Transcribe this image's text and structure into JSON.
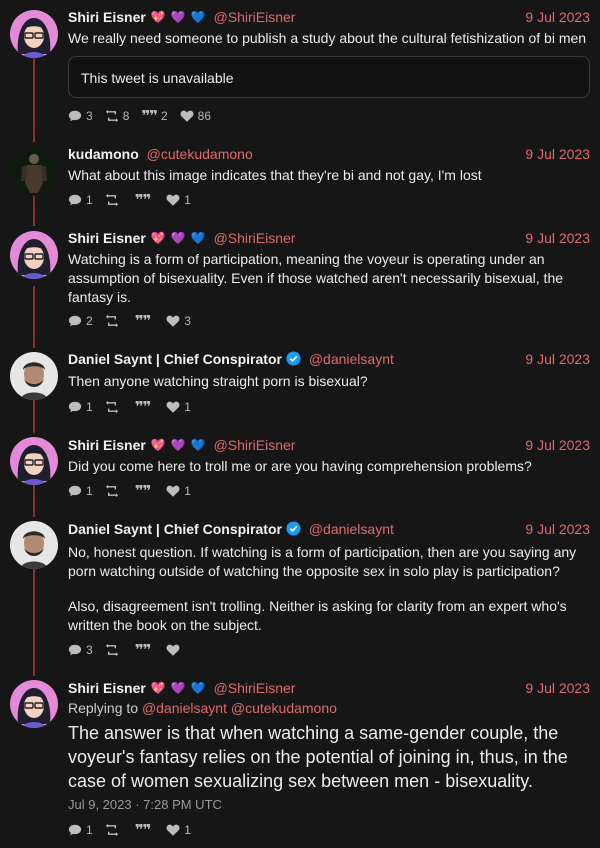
{
  "users": {
    "shiri": {
      "name": "Shiri Eisner",
      "handle": "@ShiriEisner",
      "emoji": [
        "💖",
        "💜",
        "💙"
      ]
    },
    "kuda": {
      "name": "kudamono",
      "handle": "@cutekudamono"
    },
    "daniel": {
      "name": "Daniel Saynt | Chief Conspirator",
      "handle": "@danielsaynt"
    }
  },
  "tweets": [
    {
      "date": "9 Jul 2023",
      "text": "We really need someone to publish a study about the cultural fetishization of bi men",
      "quote": "This tweet is unavailable",
      "replies": "3",
      "retweets": "8",
      "quotes": "2",
      "likes": "86"
    },
    {
      "date": "9 Jul 2023",
      "text": "What about this image indicates that they're bi and not gay, I'm lost",
      "replies": "1",
      "retweets": "",
      "quotes": "",
      "likes": "1"
    },
    {
      "date": "9 Jul 2023",
      "text": "Watching is a form of participation, meaning the voyeur is operating under an assumption of bisexuality. Even if those watched aren't necessarily bisexual, the fantasy is.",
      "replies": "2",
      "retweets": "",
      "quotes": "",
      "likes": "3"
    },
    {
      "date": "9 Jul 2023",
      "text": "Then anyone watching straight porn is bisexual?",
      "replies": "1",
      "retweets": "",
      "quotes": "",
      "likes": "1"
    },
    {
      "date": "9 Jul 2023",
      "text": "Did you come here to troll me or are you having comprehension problems?",
      "replies": "1",
      "retweets": "",
      "quotes": "",
      "likes": "1"
    },
    {
      "date": "9 Jul 2023",
      "text": "No, honest question. If watching is a form of participation, then are you saying any porn watching outside of watching the opposite sex in solo play is participation?",
      "text2": "Also, disagreement isn't trolling. Neither is asking for clarity from an expert who's written the book on the subject.",
      "replies": "3",
      "retweets": "",
      "quotes": "",
      "likes": ""
    },
    {
      "date": "9 Jul 2023",
      "replying_label": "Replying to",
      "replying_to": "@danielsaynt @cutekudamono",
      "text": "The answer is that when watching a same-gender couple, the voyeur's fantasy relies on the potential of joining in, thus, in the case of women sexualizing sex between men - bisexuality.",
      "timestamp": "Jul 9, 2023 · 7:28 PM UTC",
      "replies": "1",
      "retweets": "",
      "quotes": "",
      "likes": "1"
    }
  ],
  "icons": {
    "reply": "comment-icon",
    "retweet": "retweet-icon",
    "quote": "quote-icon",
    "like": "heart-icon",
    "verified": "verified-badge-icon"
  },
  "colors": {
    "accent": "#e06a6a",
    "thread": "#8b2e2e",
    "background": "#161616"
  }
}
